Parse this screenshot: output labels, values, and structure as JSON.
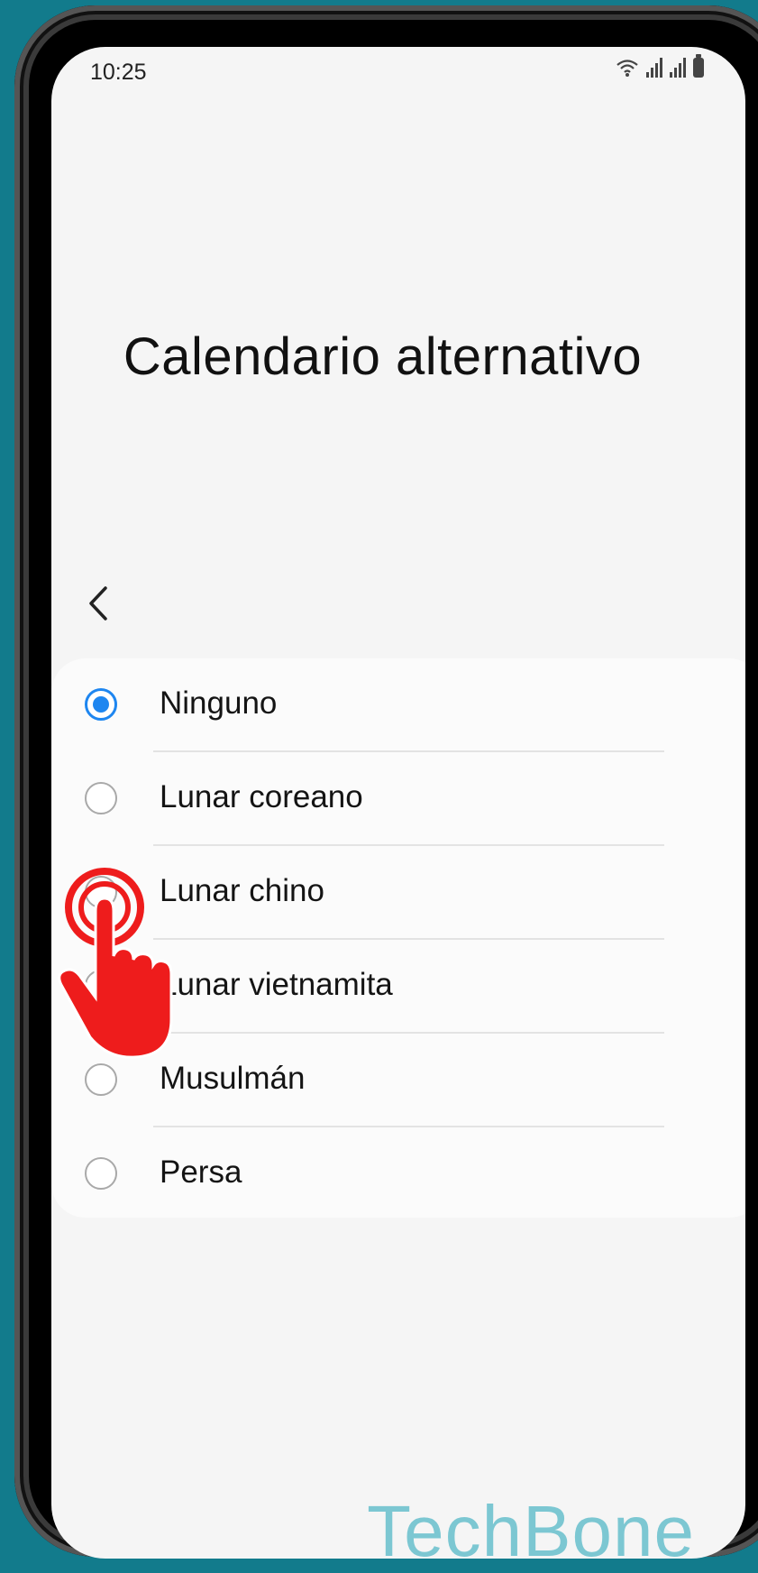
{
  "status_bar": {
    "time": "10:25",
    "icons": [
      "wifi-icon",
      "signal-icon",
      "signal-icon",
      "battery-icon"
    ]
  },
  "page": {
    "title": "Calendario alternativo",
    "back_icon": "chevron-left-icon"
  },
  "options": [
    {
      "label": "Ninguno",
      "selected": true
    },
    {
      "label": "Lunar coreano",
      "selected": false
    },
    {
      "label": "Lunar chino",
      "selected": false
    },
    {
      "label": "Lunar vietnamita",
      "selected": false
    },
    {
      "label": "Musulmán",
      "selected": false
    },
    {
      "label": "Persa",
      "selected": false
    }
  ],
  "overlay": {
    "tap_indicator_icon": "tap-hand-icon",
    "watermark": "TechBone"
  },
  "colors": {
    "background": "#127b8c",
    "accent": "#1e86f0",
    "tap_indicator": "#ee1c1c",
    "watermark": "#7cc7d2"
  }
}
